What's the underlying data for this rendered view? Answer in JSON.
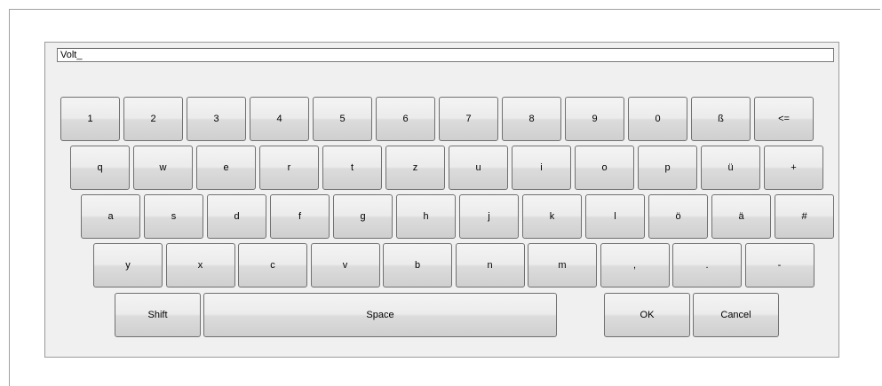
{
  "input": {
    "value": "Volt_"
  },
  "rows": [
    [
      "1",
      "2",
      "3",
      "4",
      "5",
      "6",
      "7",
      "8",
      "9",
      "0",
      "ß",
      "<="
    ],
    [
      "q",
      "w",
      "e",
      "r",
      "t",
      "z",
      "u",
      "i",
      "o",
      "p",
      "ü",
      "+"
    ],
    [
      "a",
      "s",
      "d",
      "f",
      "g",
      "h",
      "j",
      "k",
      "l",
      "ö",
      "ä",
      "#"
    ],
    [
      "y",
      "x",
      "c",
      "v",
      "b",
      "n",
      "m",
      ",",
      ".",
      "-"
    ]
  ],
  "bottom": {
    "shift": "Shift",
    "space": "Space",
    "ok": "OK",
    "cancel": "Cancel"
  }
}
